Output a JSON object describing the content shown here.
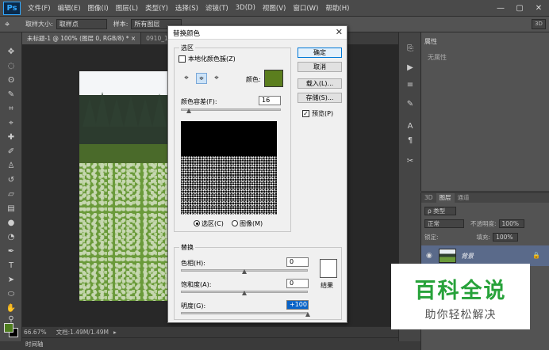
{
  "app": {
    "logo": "Ps",
    "menu": [
      "文件(F)",
      "编辑(E)",
      "图像(I)",
      "图层(L)",
      "类型(Y)",
      "选择(S)",
      "滤镜(T)",
      "3D(D)",
      "视图(V)",
      "窗口(W)",
      "帮助(H)"
    ],
    "window_controls": [
      "—",
      "▢",
      "✕"
    ]
  },
  "options_bar": {
    "size_label": "取样大小:",
    "size_value": "取样点",
    "sample_label": "样本:",
    "sample_value": "所有图层",
    "mode_3d": "3D"
  },
  "tabs": [
    {
      "label": "未标题-1 @ 100% (图层 0, RGB/8) * ×"
    },
    {
      "label": "0910_19..."
    }
  ],
  "status": {
    "zoom": "66.67%",
    "doc": "文档:1.49M/1.49M",
    "arrow": "▸",
    "timeline": "时间轴"
  },
  "properties": {
    "tab": "属性",
    "text": "无属性"
  },
  "layers": {
    "tabs": [
      "3D",
      "图层",
      "通道"
    ],
    "kind_label": "ρ 类型",
    "blend_mode": "正常",
    "opacity_label": "不透明度:",
    "opacity_value": "100%",
    "lock_label": "锁定:",
    "fill_label": "填充:",
    "fill_value": "100%",
    "layer_name": "背景"
  },
  "dialog": {
    "title": "替换颜色",
    "selection_group": "选区",
    "localized_label": "本地化颜色簇(Z)",
    "color_label": "颜色:",
    "selected_color": "#5b7e1e",
    "fuzziness_label": "颜色容差(F):",
    "fuzziness_value": "16",
    "fuzziness_level": 0.08,
    "radio_selection": "选区(C)",
    "radio_image": "图像(M)",
    "replace_group": "替换",
    "hue_label": "色相(H):",
    "hue_value": "0",
    "saturation_label": "饱和度(A):",
    "saturation_value": "0",
    "lightness_label": "明度(G):",
    "lightness_value": "+100",
    "result_label": "结果",
    "result_color": "#ffffff",
    "buttons": {
      "ok": "确定",
      "cancel": "取消",
      "load": "载入(L)...",
      "save": "存储(S)...",
      "preview": "预览(P)"
    }
  },
  "watermark": {
    "title": "百科全说",
    "subtitle": "助你轻松解决"
  }
}
